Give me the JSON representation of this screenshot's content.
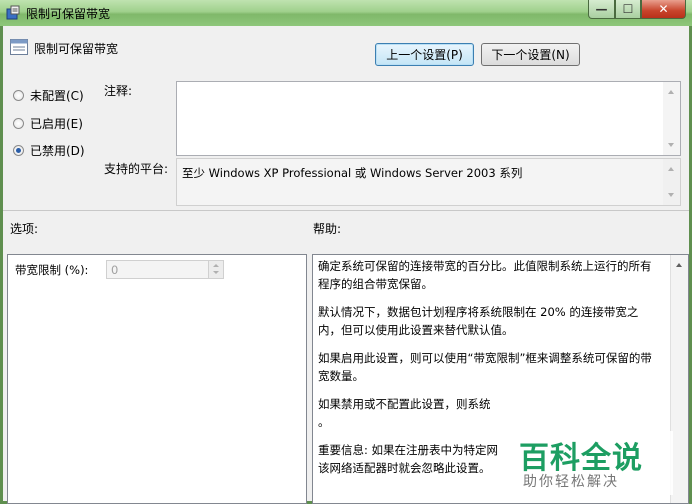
{
  "window": {
    "title": "限制可保留带宽",
    "icon": "policy-icon",
    "controls": {
      "minimize": "—",
      "maximize": "☐",
      "close": "✕"
    }
  },
  "header": {
    "setting_name": "限制可保留带宽",
    "prev_button": "上一个设置(P)",
    "next_button": "下一个设置(N)"
  },
  "state": {
    "options": [
      {
        "label": "未配置(C)",
        "selected": false
      },
      {
        "label": "已启用(E)",
        "selected": false
      },
      {
        "label": "已禁用(D)",
        "selected": true
      }
    ]
  },
  "comment": {
    "label": "注释:",
    "value": ""
  },
  "platform": {
    "label": "支持的平台:",
    "value": "至少 Windows XP Professional 或 Windows Server 2003 系列"
  },
  "sections": {
    "options_label": "选项:",
    "help_label": "帮助:"
  },
  "options_panel": {
    "bandwidth_label": "带宽限制 (%):",
    "bandwidth_value": "0"
  },
  "help": {
    "paragraphs": [
      "确定系统可保留的连接带宽的百分比。此值限制系统上运行的所有程序的组合带宽保留。",
      "默认情况下，数据包计划程序将系统限制在 20% 的连接带宽之内，但可以使用此设置来替代默认值。",
      "如果启用此设置，则可以使用“带宽限制”框来调整系统可保留的带宽数量。",
      "如果禁用或不配置此设置，则系统",
      "。",
      "重要信息: 如果在注册表中为特定网",
      "该网络适配器时就会忽略此设置。"
    ]
  },
  "watermark": {
    "brand": "百科全说",
    "slogan": "助你轻松解决"
  }
}
